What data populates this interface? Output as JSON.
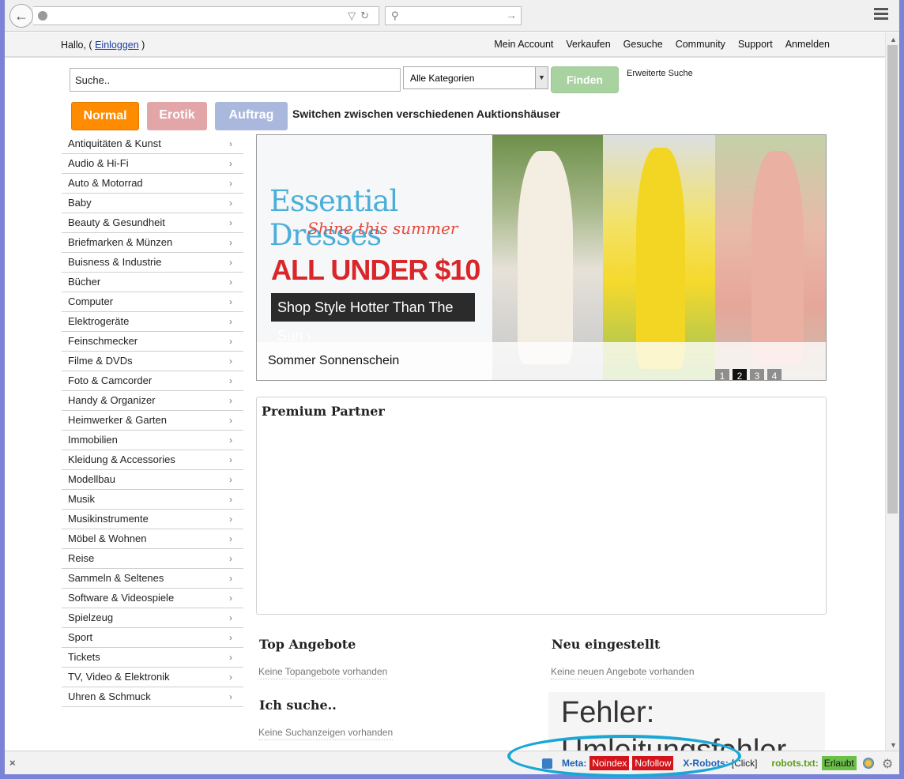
{
  "browser": {
    "search_icon": "search-icon",
    "menu_icon": "hamburger-menu-icon"
  },
  "topnav": {
    "greeting_prefix": "Hallo, (",
    "login_link": "Einloggen",
    "greeting_suffix": ")",
    "links": [
      "Mein Account",
      "Verkaufen",
      "Gesuche",
      "Community",
      "Support",
      "Anmelden"
    ]
  },
  "search": {
    "value": "Suche..",
    "category": "Alle Kategorien",
    "find_label": "Finden",
    "advanced": "Erweiterte Suche"
  },
  "switch": {
    "normal": "Normal",
    "erotik": "Erotik",
    "auftrag": "Auftrag",
    "label": "Switchen zwischen verschiedenen Auktionshäuser"
  },
  "categories": [
    "Antiquitäten & Kunst",
    "Audio & Hi-Fi",
    "Auto & Motorrad",
    "Baby",
    "Beauty & Gesundheit",
    "Briefmarken & Münzen",
    "Buisness & Industrie",
    "Bücher",
    "Computer",
    "Elektrogeräte",
    "Feinschmecker",
    "Filme & DVDs",
    "Foto & Camcorder",
    "Handy & Organizer",
    "Heimwerker & Garten",
    "Immobilien",
    "Kleidung & Accessories",
    "Modellbau",
    "Musik",
    "Musikinstrumente",
    "Möbel & Wohnen",
    "Reise",
    "Sammeln & Seltenes",
    "Software & Videospiele",
    "Spielzeug",
    "Sport",
    "Tickets",
    "TV, Video & Elektronik",
    "Uhren & Schmuck"
  ],
  "banner": {
    "title": "Essential Dresses",
    "subtitle": "Shine this summer",
    "price": "ALL UNDER $10",
    "shop": "Shop Style Hotter Than The Sun ›",
    "caption": "Sommer Sonnenschein",
    "pages": [
      "1",
      "2",
      "3",
      "4"
    ],
    "active_page": "2"
  },
  "premium": {
    "title": "Premium Partner"
  },
  "sections": {
    "top_title": "Top Angebote",
    "top_empty": "Keine Topangebote vorhanden",
    "new_title": "Neu eingestellt",
    "new_empty": "Keine neuen Angebote vorhanden",
    "search_title": "Ich suche..",
    "search_empty": "Keine Suchanzeigen vorhanden"
  },
  "error_frame": {
    "line1": "Fehler:",
    "line2": "Umleitungsfehler"
  },
  "statusbar": {
    "meta_label": "Meta:",
    "noindex": "Noindex",
    "nofollow": "Nofollow",
    "xrobots_label": "X-Robots:",
    "xrobots_value": "[Click]",
    "robots_label": "robots.txt:",
    "robots_value": "Erlaubt"
  },
  "colors": {
    "accent_orange": "#ff8c00",
    "find_green": "#a8d2a0",
    "noindex_red": "#d1151b",
    "robots_green": "#6cc04a",
    "highlight_ellipse": "#1aa7d6"
  }
}
